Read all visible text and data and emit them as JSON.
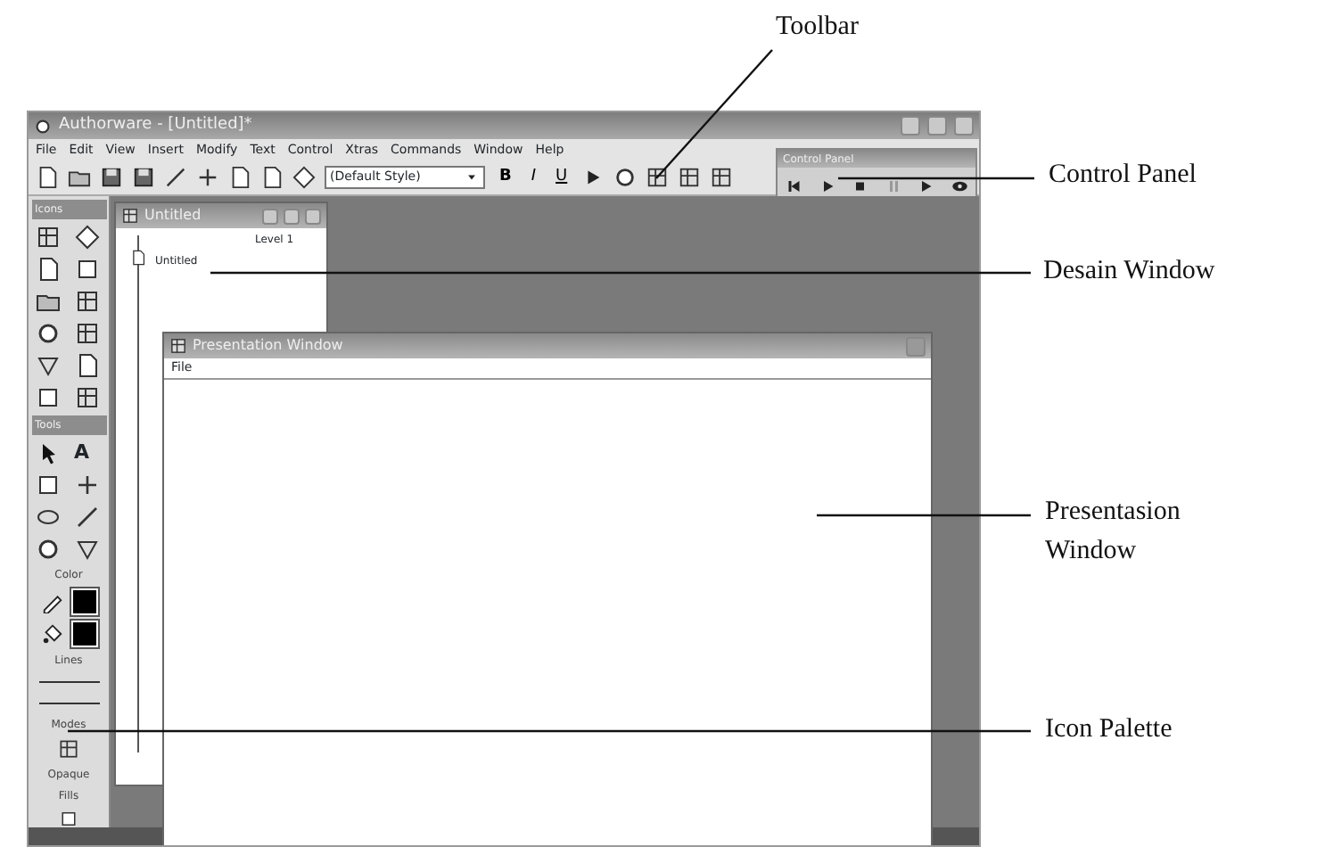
{
  "callouts": [
    {
      "label": "Toolbar"
    },
    {
      "label": "Control Panel"
    },
    {
      "label": "Desain Window"
    },
    {
      "label": "Presentasion Window"
    },
    {
      "label": "Icon Palette"
    }
  ],
  "app": {
    "title": "Authorware - [Untitled]*",
    "menu": [
      "File",
      "Edit",
      "View",
      "Insert",
      "Modify",
      "Text",
      "Control",
      "Xtras",
      "Commands",
      "Window",
      "Help"
    ],
    "style_select": "(Default Style)",
    "format_buttons": [
      "B",
      "I",
      "U"
    ],
    "control_panel": {
      "title": "Control Panel"
    },
    "palette": {
      "icons_title": "Icons",
      "tools_title": "Tools",
      "text_tool": "A",
      "colors_title": "Color",
      "lines_title": "Lines",
      "modes_title": "Modes",
      "mode_label": "Opaque",
      "fills_title": "Fills"
    },
    "design_window": {
      "title": "Untitled",
      "level": "Level 1",
      "icon_label": "Untitled"
    },
    "presentation_window": {
      "title": "Presentation Window",
      "menu": [
        "File"
      ]
    }
  }
}
